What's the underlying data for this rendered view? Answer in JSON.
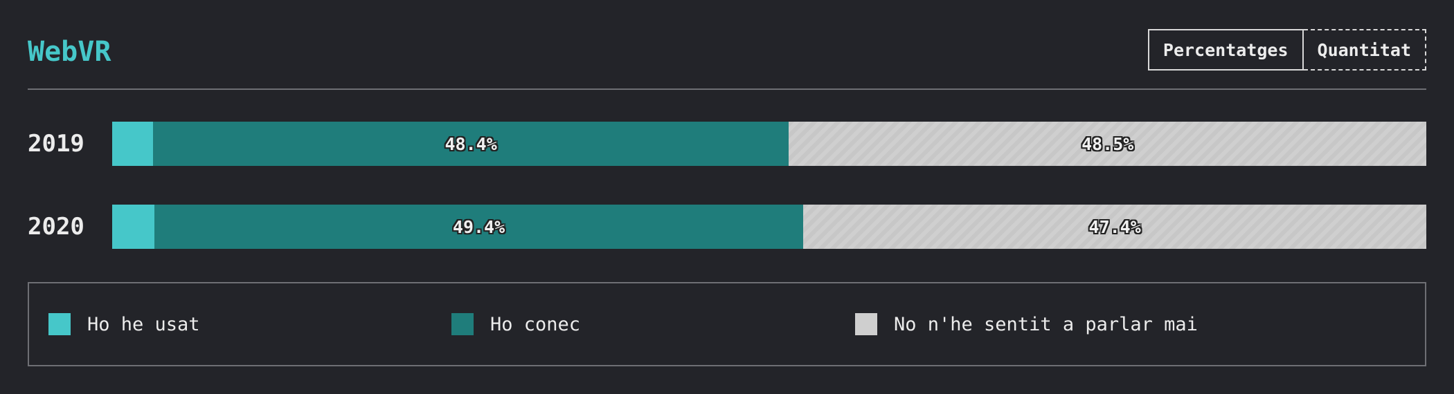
{
  "header": {
    "title": "WebVR",
    "toggle": {
      "percentages_label": "Percentatges",
      "quantity_label": "Quantitat"
    }
  },
  "colors": {
    "used": "#46c7c9",
    "known": "#1f7d7b",
    "never": "#cfcfcf",
    "background": "#232429"
  },
  "chart_data": {
    "type": "bar",
    "orientation": "horizontal",
    "stacked": true,
    "normalized": true,
    "categories": [
      "2019",
      "2020"
    ],
    "series": [
      {
        "name": "Ho he usat",
        "values": [
          3.1,
          3.2
        ]
      },
      {
        "name": "Ho conec",
        "values": [
          48.4,
          49.4
        ]
      },
      {
        "name": "No n'he sentit a parlar mai",
        "values": [
          48.5,
          47.4
        ]
      }
    ],
    "segment_labels": [
      [
        "",
        "48.4%",
        "48.5%"
      ],
      [
        "",
        "49.4%",
        "47.4%"
      ]
    ],
    "xlim": [
      0,
      100
    ],
    "legend_position": "bottom"
  }
}
